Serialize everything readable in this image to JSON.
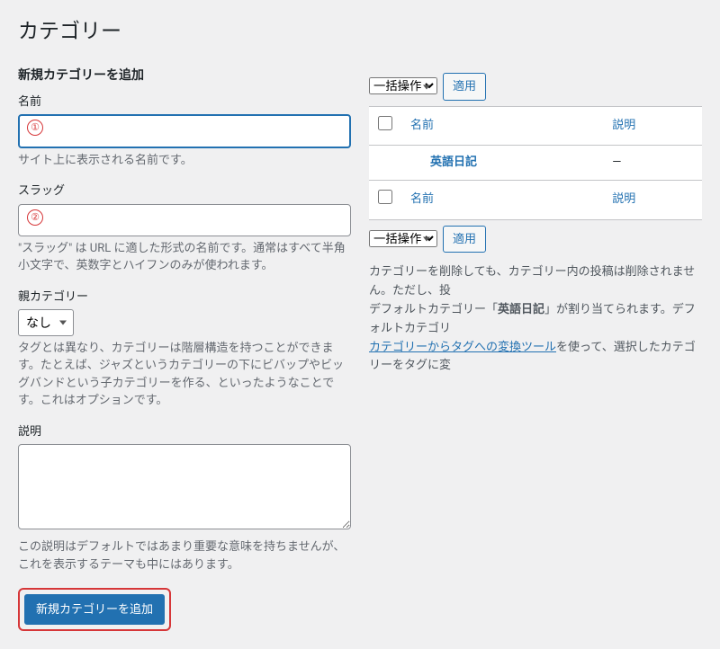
{
  "page": {
    "title": "カテゴリー"
  },
  "form": {
    "heading": "新規カテゴリーを追加",
    "name": {
      "label": "名前",
      "value": "",
      "help": "サイト上に表示される名前です。",
      "marker": "①"
    },
    "slug": {
      "label": "スラッグ",
      "value": "",
      "help": "\"スラッグ\" は URL に適した形式の名前です。通常はすべて半角小文字で、英数字とハイフンのみが使われます。",
      "marker": "②"
    },
    "parent": {
      "label": "親カテゴリー",
      "selected": "なし",
      "help": "タグとは異なり、カテゴリーは階層構造を持つことができます。たとえば、ジャズというカテゴリーの下にビバップやビッグバンドという子カテゴリーを作る、といったようなことです。これはオプションです。"
    },
    "description": {
      "label": "説明",
      "value": "",
      "help": "この説明はデフォルトではあまり重要な意味を持ちませんが、これを表示するテーマも中にはあります。"
    },
    "submit": "新規カテゴリーを追加"
  },
  "list": {
    "bulk_selected": "一括操作",
    "apply": "適用",
    "columns": {
      "name": "名前",
      "description": "説明"
    },
    "rows": [
      {
        "name": "英語日記",
        "description": "—"
      }
    ],
    "note": {
      "line1_a": "カテゴリーを削除しても、カテゴリー内の投稿は削除されません。ただし、投",
      "line1_b": "デフォルトカテゴリー「",
      "line1_bold": "英語日記",
      "line1_c": "」が割り当てられます。デフォルトカテゴリ",
      "link": "カテゴリーからタグへの変換ツール",
      "line2": "を使って、選択したカテゴリーをタグに変"
    }
  }
}
